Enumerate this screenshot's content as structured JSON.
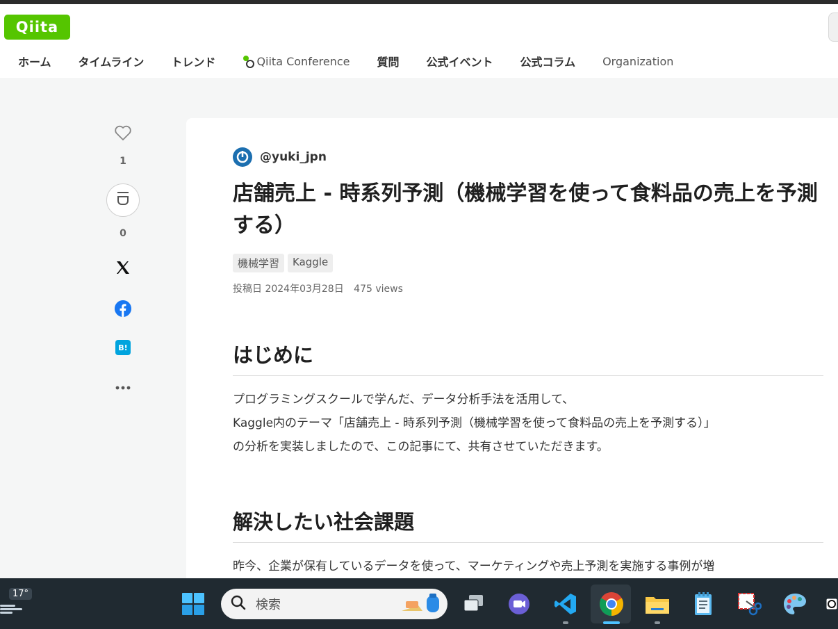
{
  "header": {
    "logo": "Qiita",
    "nav": [
      {
        "label": "ホーム"
      },
      {
        "label": "タイムライン"
      },
      {
        "label": "トレンド"
      },
      {
        "label": "Qiita Conference"
      },
      {
        "label": "質問"
      },
      {
        "label": "公式イベント"
      },
      {
        "label": "公式コラム"
      },
      {
        "label": "Organization"
      }
    ]
  },
  "side_actions": {
    "like_count": "1",
    "stock_count": "0",
    "icons": [
      "heart-icon",
      "stock-icon",
      "x-icon",
      "facebook-icon",
      "hatena-bookmark-icon",
      "more-icon"
    ],
    "hatena_label": "B!"
  },
  "article": {
    "author": "@yuki_jpn",
    "title": "店舗売上 - 時系列予測（機械学習を使って食料品の売上を予測する）",
    "tags": [
      "機械学習",
      "Kaggle"
    ],
    "posted_label": "投稿日 2024年03月28日",
    "views": "475 views",
    "sections": [
      {
        "heading": "はじめに",
        "lines": [
          "プログラミングスクールで学んだ、データ分析手法を活用して、",
          "Kaggle内のテーマ「店舗売上 - 時系列予測（機械学習を使って食料品の売上を予測する）」",
          "の分析を実装しましたので、この記事にて、共有させていただきます。"
        ]
      },
      {
        "heading": "解決したい社会課題",
        "lines": [
          "昨今、企業が保有しているデータを使って、マーケティングや売上予測を実施する事例が増"
        ]
      }
    ]
  },
  "taskbar": {
    "temperature": "17°",
    "search_placeholder": "検索",
    "apps": [
      "start-icon",
      "task-view-icon",
      "teams-icon",
      "vscode-icon",
      "chrome-icon",
      "file-explorer-icon",
      "notepad-icon",
      "snipping-tool-icon",
      "paint-icon"
    ]
  },
  "colors": {
    "brand": "#55c500",
    "facebook": "#1877f2",
    "hatena": "#00a4de",
    "taskbar": "#202a31"
  }
}
